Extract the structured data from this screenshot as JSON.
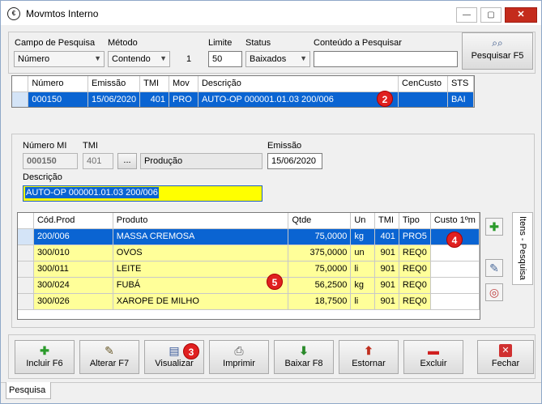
{
  "window": {
    "title": "Movmtos Interno"
  },
  "filters": {
    "campo_label": "Campo de Pesquisa",
    "campo_value": "Número",
    "metodo_label": "Método",
    "metodo_value": "Contendo",
    "count": "1",
    "limite_label": "Limite",
    "limite_value": "50",
    "status_label": "Status",
    "status_value": "Baixados",
    "conteudo_label": "Conteúdo a Pesquisar",
    "conteudo_value": "",
    "search_button": "Pesquisar F5"
  },
  "main_grid": {
    "columns": [
      "Número",
      "Emissão",
      "TMI",
      "Mov",
      "Descrição",
      "CenCusto",
      "STS"
    ],
    "rows": [
      {
        "numero": "000150",
        "emissao": "15/06/2020",
        "tmi": "401",
        "mov": "PRO",
        "descricao": "AUTO-OP 000001.01.03  200/006",
        "cencusto": "",
        "sts": "BAI"
      }
    ]
  },
  "detail": {
    "numero_label": "Número MI",
    "numero_value": "000150",
    "tmi_label": "TMI",
    "tmi_value": "401",
    "tmi_button": "...",
    "tmi_desc": "Produção",
    "emissao_label": "Emissão",
    "emissao_value": "15/06/2020",
    "descricao_label": "Descrição",
    "descricao_value": "AUTO-OP 000001.01.03  200/006"
  },
  "items_grid": {
    "columns": [
      "Cód.Prod",
      "Produto",
      "Qtde",
      "Un",
      "TMI",
      "Tipo",
      "Custo 1ºm"
    ],
    "rows": [
      {
        "cod": "200/006",
        "produto": "MASSA CREMOSA",
        "qtde": "75,0000",
        "un": "kg",
        "tmi": "401",
        "tipo": "PRO5",
        "custo": ""
      },
      {
        "cod": "300/010",
        "produto": "OVOS",
        "qtde": "375,0000",
        "un": "un",
        "tmi": "901",
        "tipo": "REQ0",
        "custo": ""
      },
      {
        "cod": "300/011",
        "produto": "LEITE",
        "qtde": "75,0000",
        "un": "li",
        "tmi": "901",
        "tipo": "REQ0",
        "custo": ""
      },
      {
        "cod": "300/024",
        "produto": "FUBÁ",
        "qtde": "56,2500",
        "un": "kg",
        "tmi": "901",
        "tipo": "REQ0",
        "custo": ""
      },
      {
        "cod": "300/026",
        "produto": "XAROPE DE MILHO",
        "qtde": "18,7500",
        "un": "li",
        "tmi": "901",
        "tipo": "REQ0",
        "custo": ""
      }
    ]
  },
  "side_tab": "Itens - Pesquisa",
  "markers": [
    "2",
    "3",
    "4",
    "5"
  ],
  "toolbar": {
    "incluir": "Incluir F6",
    "alterar": "Alterar F7",
    "visualizar": "Visualizar",
    "imprimir": "Imprimir",
    "baixar": "Baixar F8",
    "estornar": "Estornar",
    "excluir": "Excluir",
    "fechar": "Fechar"
  },
  "bottom_tab": "Pesquisa",
  "colors": {
    "selection": "#0a64d2",
    "highlight": "#ffff99",
    "marker": "#e02020"
  }
}
